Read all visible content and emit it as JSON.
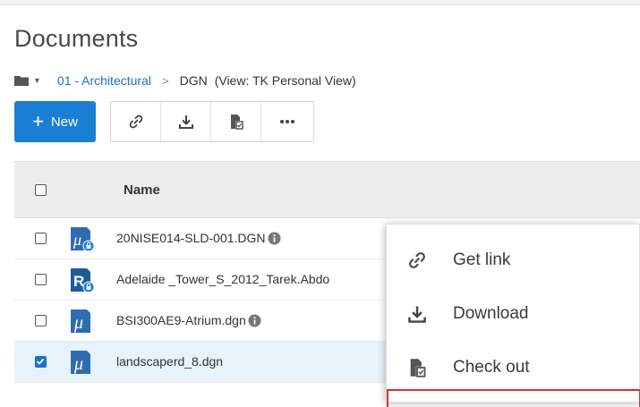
{
  "page": {
    "title": "Documents"
  },
  "breadcrumb": {
    "folder_icon": "folder-icon",
    "path_link": "01 - Architectural",
    "separator": ">",
    "current": "DGN",
    "view": "(View: TK Personal View)"
  },
  "toolbar": {
    "new_label": "New",
    "tools": [
      "link-icon",
      "download-icon",
      "check-out-icon",
      "more-icon"
    ]
  },
  "grid": {
    "header_name": "Name",
    "rows": [
      {
        "name": "20NISE014-SLD-001.DGN",
        "icon": "microstation-locked-file-icon",
        "info": true,
        "checked": false
      },
      {
        "name": "Adelaide _Tower_S_2012_Tarek.Abdo",
        "icon": "revit-locked-file-icon",
        "info": false,
        "checked": false
      },
      {
        "name": "BSI300AE9-Atrium.dgn",
        "icon": "microstation-file-icon",
        "info": true,
        "checked": false
      },
      {
        "name": "landscaperd_8.dgn",
        "icon": "microstation-file-icon",
        "info": false,
        "checked": true
      }
    ]
  },
  "context_menu": {
    "items": [
      {
        "label": "Get link",
        "icon": "link-icon"
      },
      {
        "label": "Download",
        "icon": "download-icon"
      },
      {
        "label": "Check out",
        "icon": "check-out-icon"
      }
    ]
  },
  "colors": {
    "accent": "#1a7fd3",
    "link": "#1a73c8",
    "selected_row": "#e8f2fb",
    "highlight_border": "#d9302c"
  }
}
